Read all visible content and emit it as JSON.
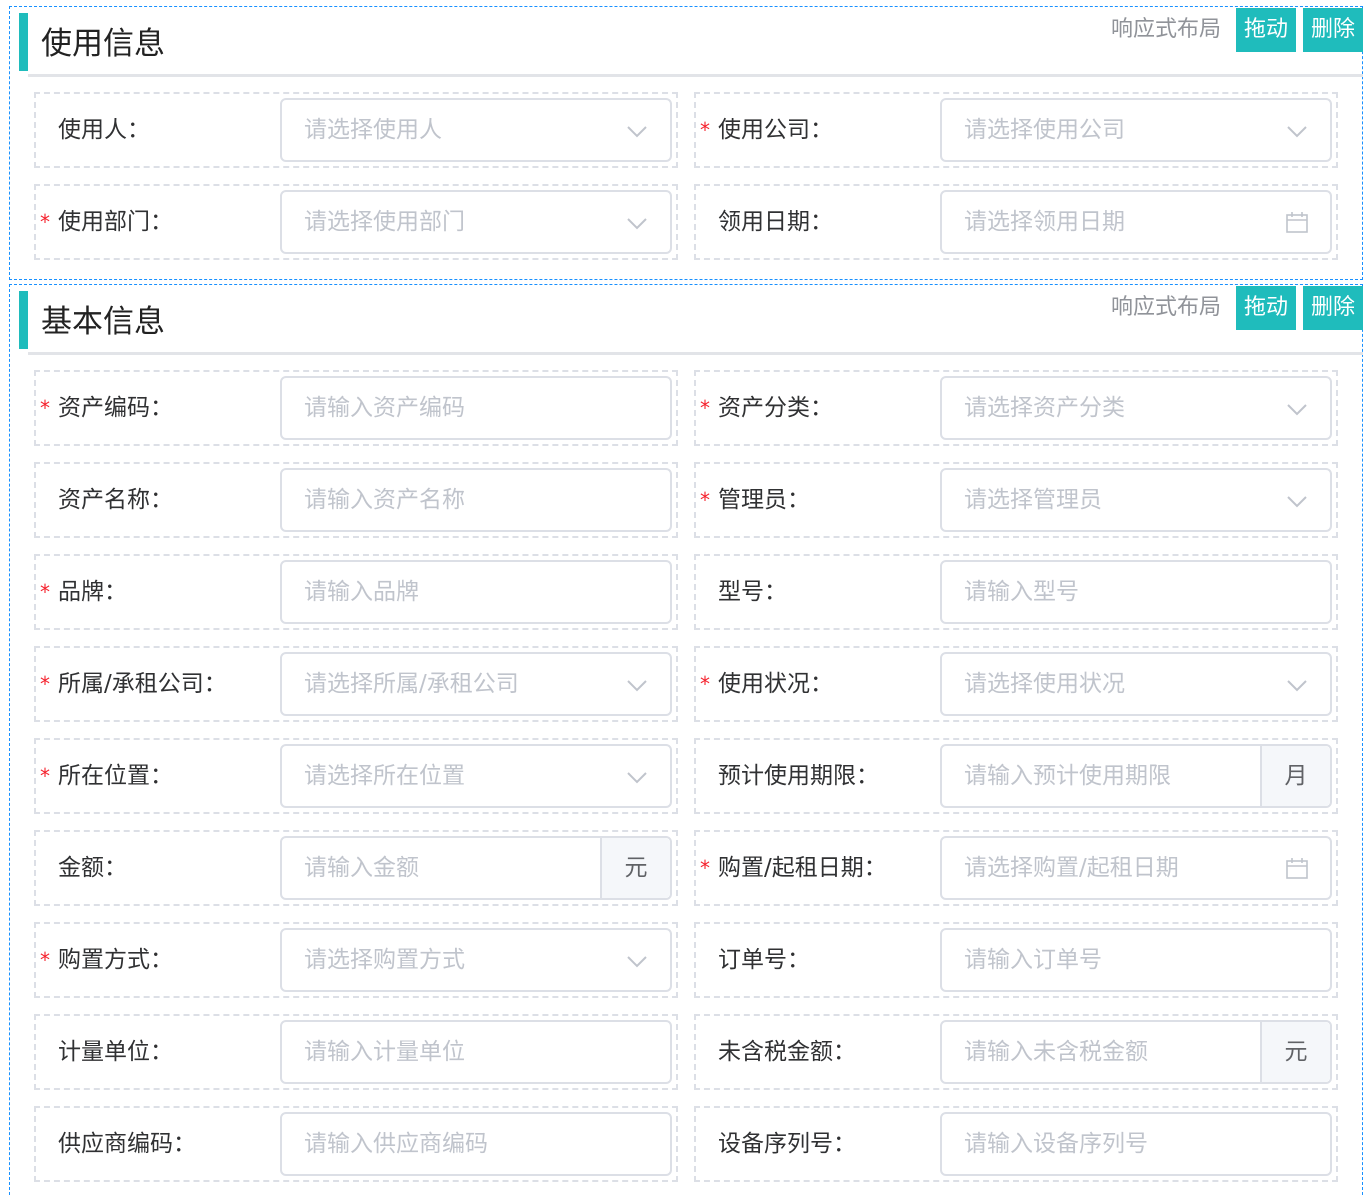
{
  "tools": {
    "layout": "响应式布局",
    "drag": "拖动",
    "delete": "删除"
  },
  "usage": {
    "title": "使用信息",
    "rows": [
      [
        {
          "label": "使用人：",
          "placeholder": "请选择使用人",
          "type": "select",
          "required": false
        },
        {
          "label": "使用公司：",
          "placeholder": "请选择使用公司",
          "type": "select",
          "required": true
        }
      ],
      [
        {
          "label": "使用部门：",
          "placeholder": "请选择使用部门",
          "type": "select",
          "required": true
        },
        {
          "label": "领用日期：",
          "placeholder": "请选择领用日期",
          "type": "date",
          "required": false
        }
      ]
    ]
  },
  "basic": {
    "title": "基本信息",
    "rows": [
      [
        {
          "label": "资产编码：",
          "placeholder": "请输入资产编码",
          "type": "input",
          "required": true
        },
        {
          "label": "资产分类：",
          "placeholder": "请选择资产分类",
          "type": "select",
          "required": true
        }
      ],
      [
        {
          "label": "资产名称：",
          "placeholder": "请输入资产名称",
          "type": "input",
          "required": false
        },
        {
          "label": "管理员：",
          "placeholder": "请选择管理员",
          "type": "select",
          "required": true
        }
      ],
      [
        {
          "label": "品牌：",
          "placeholder": "请输入品牌",
          "type": "input",
          "required": true
        },
        {
          "label": "型号：",
          "placeholder": "请输入型号",
          "type": "input",
          "required": false
        }
      ],
      [
        {
          "label": "所属/承租公司：",
          "placeholder": "请选择所属/承租公司",
          "type": "select",
          "required": true
        },
        {
          "label": "使用状况：",
          "placeholder": "请选择使用状况",
          "type": "select",
          "required": true
        }
      ],
      [
        {
          "label": "所在位置：",
          "placeholder": "请选择所在位置",
          "type": "select",
          "required": true
        },
        {
          "label": "预计使用期限：",
          "placeholder": "请输入预计使用期限",
          "type": "append",
          "append": "月",
          "required": false
        }
      ],
      [
        {
          "label": "金额：",
          "placeholder": "请输入金额",
          "type": "append",
          "append": "元",
          "required": false
        },
        {
          "label": "购置/起租日期：",
          "placeholder": "请选择购置/起租日期",
          "type": "date",
          "required": true
        }
      ],
      [
        {
          "label": "购置方式：",
          "placeholder": "请选择购置方式",
          "type": "select",
          "required": true
        },
        {
          "label": "订单号：",
          "placeholder": "请输入订单号",
          "type": "input",
          "required": false
        }
      ],
      [
        {
          "label": "计量单位：",
          "placeholder": "请输入计量单位",
          "type": "input",
          "required": false
        },
        {
          "label": "未含税金额：",
          "placeholder": "请输入未含税金额",
          "type": "append",
          "append": "元",
          "required": false
        }
      ],
      [
        {
          "label": "供应商编码：",
          "placeholder": "请输入供应商编码",
          "type": "input",
          "required": false
        },
        {
          "label": "设备序列号：",
          "placeholder": "请输入设备序列号",
          "type": "input",
          "required": false
        }
      ]
    ]
  },
  "colors": {
    "accent": "#1fbcbc",
    "required": "#f5222d",
    "border": "#dcdfe6",
    "placeholder": "#c0c4cc",
    "frame": "#1890ff"
  }
}
